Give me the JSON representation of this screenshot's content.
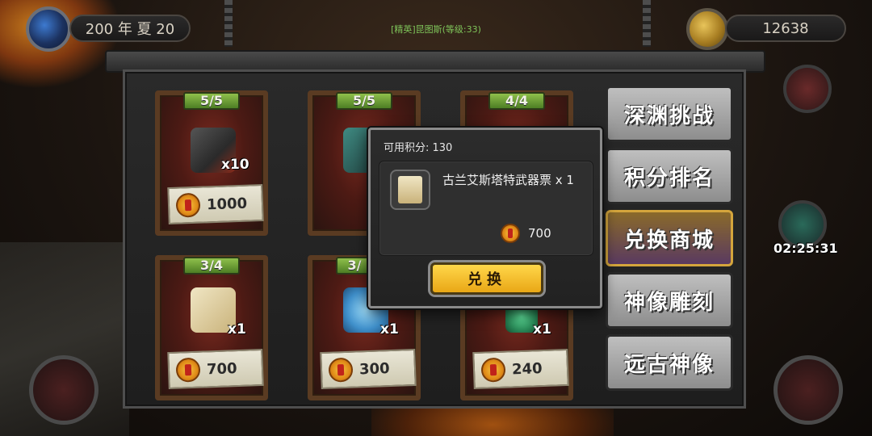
{
  "hud": {
    "date": "200 年 夏 20",
    "npc_label": "[精英]昆图斯(等级:33)",
    "coins": "12638"
  },
  "shop": {
    "items": [
      {
        "stock": "5/5",
        "qty": "x10",
        "price": "1000",
        "icon": "dark-cube-icon",
        "color": "#3a3a3a"
      },
      {
        "stock": "5/5",
        "qty": "",
        "price": "",
        "icon": "teal-cube-icon",
        "color": "#2f6b66"
      },
      {
        "stock": "4/4",
        "qty": "",
        "price": "",
        "icon": "orb-icon",
        "color": "#7a3a2a"
      },
      {
        "stock": "3/4",
        "qty": "x1",
        "price": "700",
        "icon": "weapon-ticket-icon",
        "color": "#e6d7a8"
      },
      {
        "stock": "3/",
        "qty": "x1",
        "price": "300",
        "icon": "blue-crystal-icon",
        "color": "#5fb3e6"
      },
      {
        "stock": "",
        "qty": "x1",
        "price": "240",
        "icon": "green-crystal-icon",
        "color": "#2f8f5a"
      }
    ]
  },
  "menu": {
    "items": [
      {
        "label": "深渊挑战",
        "active": false
      },
      {
        "label": "积分排名",
        "active": false
      },
      {
        "label": "兑换商城",
        "active": true
      },
      {
        "label": "神像雕刻",
        "active": false
      },
      {
        "label": "远古神像",
        "active": false
      }
    ]
  },
  "event_timer": "02:25:31",
  "popup": {
    "points_label": "可用积分: 130",
    "item_name": "古兰艾斯塔特武器票 x 1",
    "price": "700",
    "redeem_label": "兑换"
  }
}
